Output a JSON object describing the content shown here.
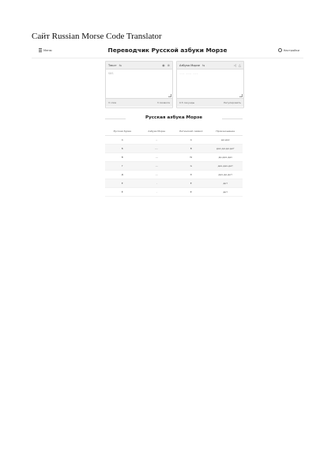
{
  "doc_title": "Сайт Russian Morse Code Translator",
  "header": {
    "menu_label": "Меню",
    "title": "Переводчик Русской азбуки Морзе",
    "settings_label": "Настройки"
  },
  "input_panel": {
    "label": "Текст",
    "swap_icon": "swap-icon",
    "value": "SOS",
    "footer_left": "3 слов",
    "footer_right": "3 символа"
  },
  "output_panel": {
    "label": "Азбука Морзе",
    "value": "... --- ...",
    "footer_left": "0.5 секунды",
    "footer_right": "Регулировать"
  },
  "section_title": "Русская азбука Морзе",
  "table": {
    "headers": [
      "Русская буква",
      "Азбука Морзе",
      "Латинский символ",
      "Произношение"
    ],
    "rows": [
      [
        "А",
        ".-",
        "A",
        "ди-дах"
      ],
      [
        "Б",
        "-...",
        "B",
        "дах-ди-ди-дит"
      ],
      [
        "В",
        ".--",
        "W",
        "ди-дах-дах"
      ],
      [
        "Г",
        "--.",
        "G",
        "дах-дах-дит"
      ],
      [
        "Д",
        "-..",
        "D",
        "дах-ди-дит"
      ],
      [
        "Е",
        ".",
        "E",
        "дит"
      ],
      [
        "Ё",
        ".",
        "E",
        "дит"
      ]
    ]
  }
}
